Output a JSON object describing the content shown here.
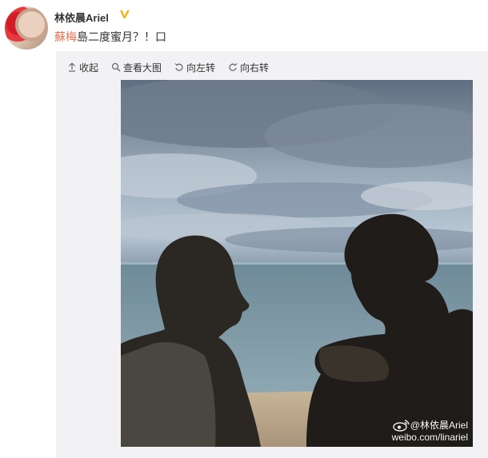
{
  "user": {
    "name": "林依晨Ariel",
    "verified_color": "#f5b30f"
  },
  "post": {
    "mention": "蘇梅",
    "text": "島二度蜜月？！",
    "trailing": "口"
  },
  "toolbar": {
    "collapse": "收起",
    "view_large": "查看大图",
    "rotate_left": "向左转",
    "rotate_right": "向右转"
  },
  "photo": {
    "watermark_handle": "@林依晨Ariel",
    "watermark_url": "weibo.com/linariel"
  },
  "colors": {
    "mention": "#eb7350",
    "card_bg": "#f2f2f5"
  }
}
